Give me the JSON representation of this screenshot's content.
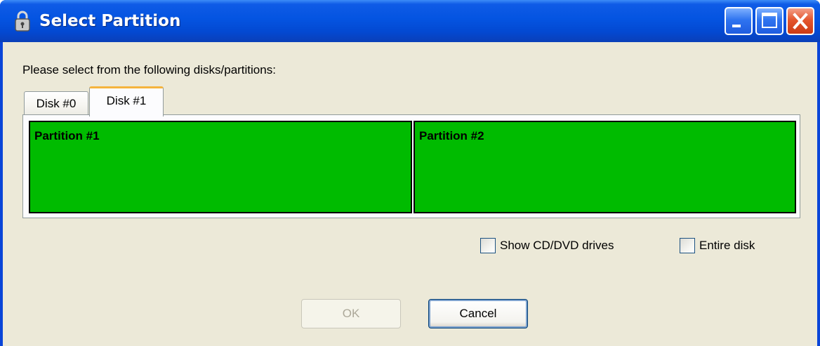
{
  "window": {
    "title": "Select Partition",
    "icon": "lock-icon",
    "controls": [
      "minimize-icon",
      "maximize-icon",
      "close-icon"
    ]
  },
  "instruction": "Please select from the following disks/partitions:",
  "tabs": [
    {
      "label": "Disk #0",
      "selected": false
    },
    {
      "label": "Disk #1",
      "selected": true
    }
  ],
  "partitions": [
    {
      "label": "Partition #1",
      "color": "#00bb00"
    },
    {
      "label": "Partition #2",
      "color": "#00bb00"
    }
  ],
  "options": {
    "show_cd_dvd": {
      "label": "Show CD/DVD drives",
      "checked": false
    },
    "entire_disk": {
      "label": "Entire disk",
      "checked": false
    }
  },
  "buttons": {
    "ok": {
      "label": "OK",
      "enabled": false
    },
    "cancel": {
      "label": "Cancel",
      "enabled": true
    }
  },
  "colors": {
    "titlebar": "#0454e1",
    "client_bg": "#ece9d8",
    "partition": "#00bb00",
    "active_tab_accent": "#f5b43d"
  }
}
